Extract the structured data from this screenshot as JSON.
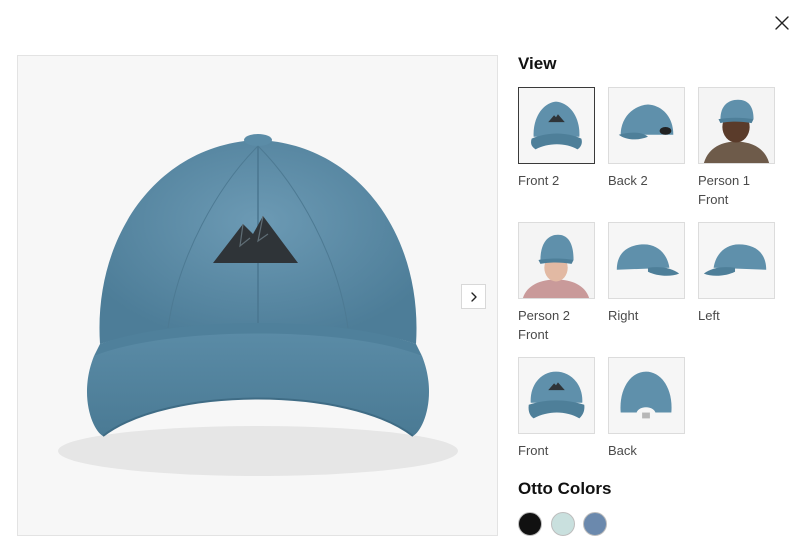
{
  "view": {
    "heading": "View",
    "thumbnails": [
      {
        "label": "Front 2",
        "selected": true
      },
      {
        "label": "Back 2",
        "selected": false
      },
      {
        "label": "Person 1 Front",
        "selected": false
      },
      {
        "label": "Person 2 Front",
        "selected": false
      },
      {
        "label": "Right",
        "selected": false
      },
      {
        "label": "Left",
        "selected": false
      },
      {
        "label": "Front",
        "selected": false
      },
      {
        "label": "Back",
        "selected": false
      }
    ]
  },
  "colors": {
    "heading": "Otto Colors",
    "swatches": [
      {
        "name": "black",
        "hex": "#111111"
      },
      {
        "name": "light-blue",
        "hex": "#c9e0de"
      },
      {
        "name": "denim-blue",
        "hex": "#6b89ad"
      }
    ]
  },
  "product": {
    "cap_color": "#5f90ab",
    "logo_color": "#2f3438"
  },
  "icons": {
    "close": "close-icon",
    "next": "chevron-right-icon"
  }
}
